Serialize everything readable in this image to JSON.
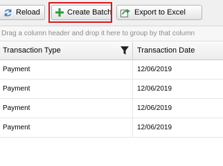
{
  "toolbar": {
    "reload_label": "Reload",
    "create_batch_label": "Create Batch",
    "export_label": "Export to Excel",
    "icons": {
      "reload": "refresh-icon",
      "create_batch": "plus-icon",
      "export": "export-icon"
    },
    "colors": {
      "reload_icon": "#3a7fc4",
      "plus_icon": "#2e9a3a",
      "export_icon": "#2e9a3a",
      "highlight": "#d9161c"
    }
  },
  "group_bar": {
    "hint": "Drag a column header and drop it here to group by that column"
  },
  "grid": {
    "columns": [
      {
        "label": "Transaction Type"
      },
      {
        "label": "Transaction Date"
      }
    ],
    "rows": [
      {
        "type": "Payment",
        "date": "12/06/2019"
      },
      {
        "type": "Payment",
        "date": "12/06/2019"
      },
      {
        "type": "Payment",
        "date": "12/06/2019"
      },
      {
        "type": "Payment",
        "date": "12/06/2019"
      }
    ]
  }
}
